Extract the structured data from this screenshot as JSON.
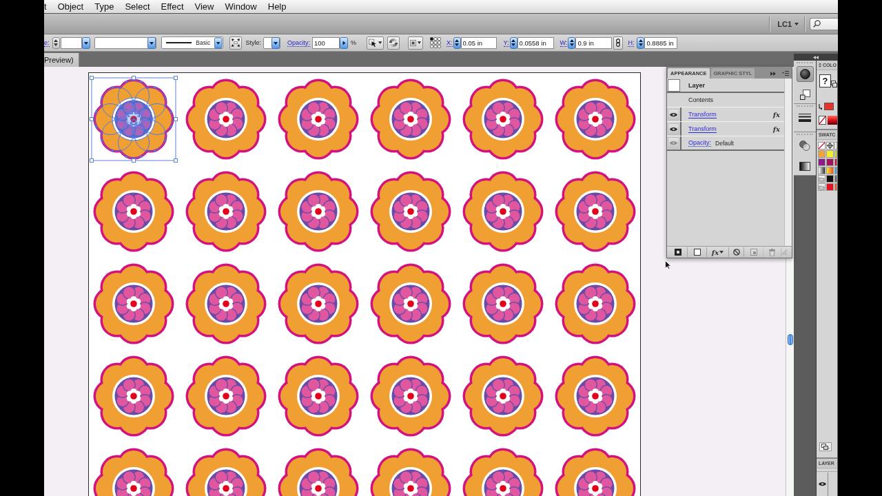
{
  "menu_bar": {
    "items": [
      "t",
      "Object",
      "Type",
      "Select",
      "Effect",
      "View",
      "Window",
      "Help"
    ]
  },
  "app_bar": {
    "workspace": "LC1"
  },
  "control_bar": {
    "stroke_link": "e:",
    "brush": "Basic",
    "style_label": "Style:",
    "opacity_link": "Opacity:",
    "opacity": "100",
    "percent": "%",
    "transform_fields": [
      {
        "label": "X:",
        "value": "0.05 in"
      },
      {
        "label": "Y:",
        "value": "0.0558 in"
      },
      {
        "label": "W:",
        "value": "0.9 in"
      },
      {
        "label": "H:",
        "value": "0.8885 in"
      }
    ]
  },
  "document_tab": {
    "title": "Preview)"
  },
  "artboard": {
    "rows": [
      [
        {
          "selected": true
        },
        {
          "selected": false
        },
        {
          "selected": false
        },
        {
          "selected": false
        },
        {
          "selected": false
        },
        {
          "selected": false
        }
      ],
      [
        {
          "selected": false
        },
        {
          "selected": false
        },
        {
          "selected": false
        },
        {
          "selected": false
        },
        {
          "selected": false
        },
        {
          "selected": false
        }
      ],
      [
        {
          "selected": false
        },
        {
          "selected": false
        },
        {
          "selected": false
        },
        {
          "selected": false
        },
        {
          "selected": false
        },
        {
          "selected": false
        }
      ],
      [
        {
          "selected": false
        },
        {
          "selected": false
        },
        {
          "selected": false
        },
        {
          "selected": false
        },
        {
          "selected": false
        },
        {
          "selected": false
        }
      ],
      [
        {
          "selected": false
        },
        {
          "selected": false
        },
        {
          "selected": false
        },
        {
          "selected": false
        },
        {
          "selected": false
        },
        {
          "selected": false
        }
      ]
    ]
  },
  "appearance_panel": {
    "tabs": [
      {
        "label": "APPEARANCE",
        "selected": true
      },
      {
        "label": "GRAPHIC STYL",
        "selected": false
      }
    ],
    "rows": [
      {
        "kind": "target",
        "label": "Layer"
      },
      {
        "kind": "contents",
        "label": "Contents"
      },
      {
        "kind": "effect",
        "label": "Transform",
        "visible": true,
        "badge": "fx"
      },
      {
        "kind": "effect",
        "label": "Transform",
        "visible": true,
        "badge": "fx"
      },
      {
        "kind": "opacity",
        "label": "Opacity:",
        "value": "Default",
        "visible": true
      }
    ],
    "footer_buttons": [
      {
        "kind": "stroke",
        "disabled": false
      },
      {
        "kind": "fill",
        "disabled": false
      },
      {
        "kind": "effects",
        "label": "fx",
        "disabled": false
      },
      {
        "kind": "clear",
        "disabled": false
      },
      {
        "kind": "duplicate",
        "disabled": true
      },
      {
        "kind": "delete",
        "disabled": true
      }
    ]
  },
  "dock": {
    "groups": [
      [
        {
          "kind": "color",
          "selected": true
        },
        {
          "kind": "guide",
          "selected": false
        }
      ],
      [
        {
          "kind": "stroke",
          "selected": false
        }
      ],
      [
        {
          "kind": "transparency",
          "selected": false
        },
        {
          "kind": "gradient",
          "selected": false
        }
      ]
    ]
  },
  "side_panel": {
    "color_title": "COLO",
    "gamut_warning": "?",
    "swatches_title": "SWATC",
    "swatches": [
      {
        "kind": "none"
      },
      {
        "kind": "registration"
      },
      {
        "kind": "color",
        "color": "#ffffff"
      },
      {
        "kind": "color",
        "color": "#f0a33a"
      },
      {
        "kind": "color",
        "color": "#f4ee2e"
      },
      {
        "kind": "color",
        "color": "#c9e02c"
      },
      {
        "kind": "color",
        "color": "#8d1b8b"
      },
      {
        "kind": "color",
        "color": "#a0165e"
      },
      {
        "kind": "color",
        "color": "#c8123a"
      },
      {
        "kind": "grayramp"
      },
      {
        "kind": "warmramp"
      },
      {
        "kind": "color",
        "color": "#4b9fd9"
      },
      {
        "kind": "folder"
      },
      {
        "kind": "color",
        "color": "#111111"
      },
      {
        "kind": "color",
        "color": "#666666"
      },
      {
        "kind": "folder"
      },
      {
        "kind": "color",
        "color": "#e5121f"
      },
      {
        "kind": "color",
        "color": "#e8602a"
      }
    ],
    "layers_title": "LAYER"
  }
}
